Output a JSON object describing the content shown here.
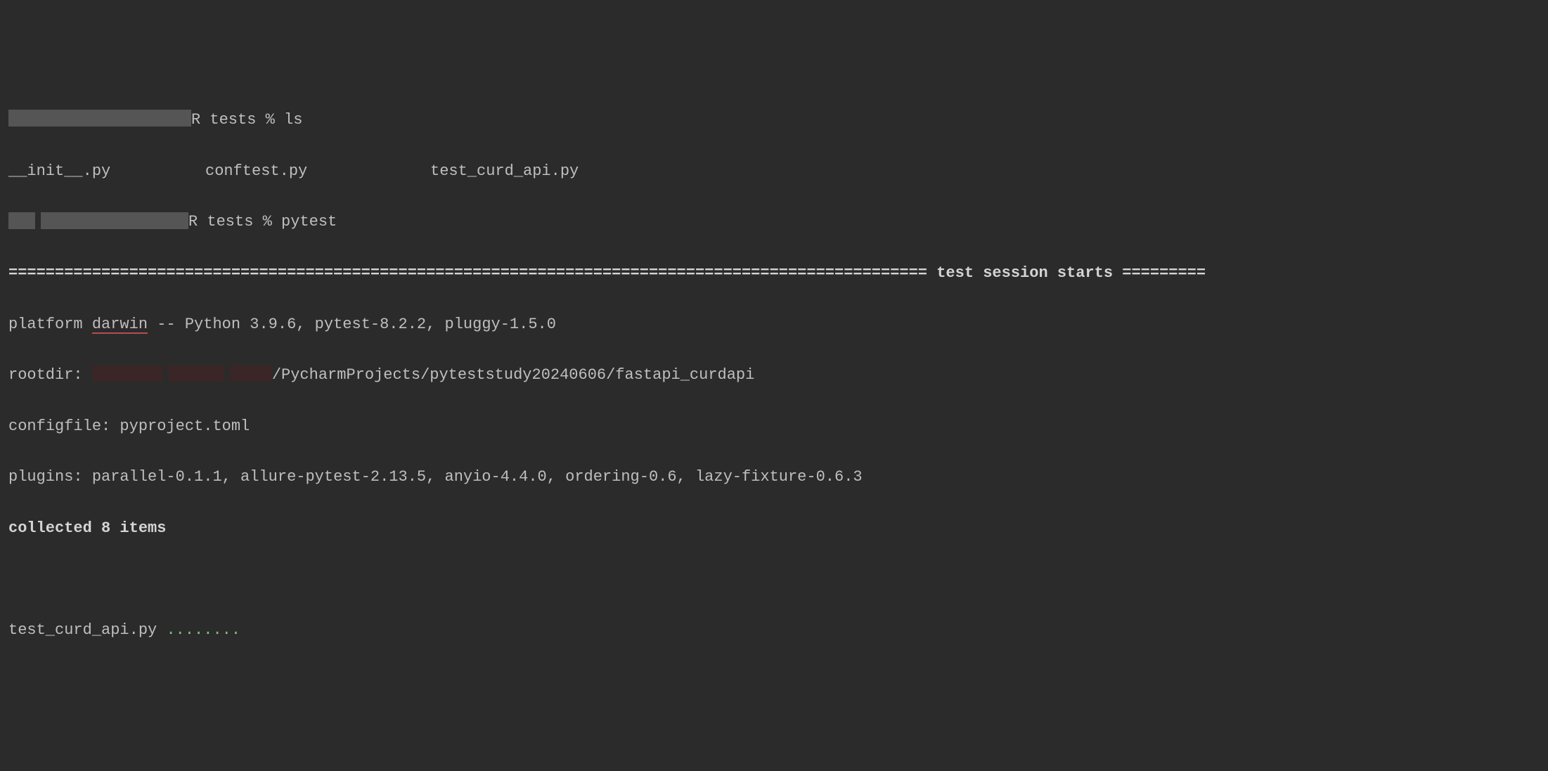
{
  "prompt1": {
    "suffix": "R tests % ls"
  },
  "ls_output": {
    "file1": "__init__.py",
    "file2": "conftest.py",
    "file3": "test_curd_api.py"
  },
  "prompt2": {
    "suffix": "R tests % pytest"
  },
  "session_header": {
    "left_equals": "===================================================================================================",
    "title": " test session starts ",
    "right_equals": "========="
  },
  "platform_line": {
    "prefix": "platform ",
    "darwin": "darwin",
    "rest": " -- Python 3.9.6, pytest-8.2.2, pluggy-1.5.0"
  },
  "rootdir": {
    "label": "rootdir: ",
    "path_suffix": "/PycharmProjects/pyteststudy20240606/fastapi_curdapi"
  },
  "configfile": "configfile: pyproject.toml",
  "plugins": "plugins: parallel-0.1.1, allure-pytest-2.13.5, anyio-4.4.0, ordering-0.6, lazy-fixture-0.6.3",
  "collected": "collected 8 items",
  "test_result": {
    "file": "test_curd_api.py ",
    "dots": "........"
  }
}
